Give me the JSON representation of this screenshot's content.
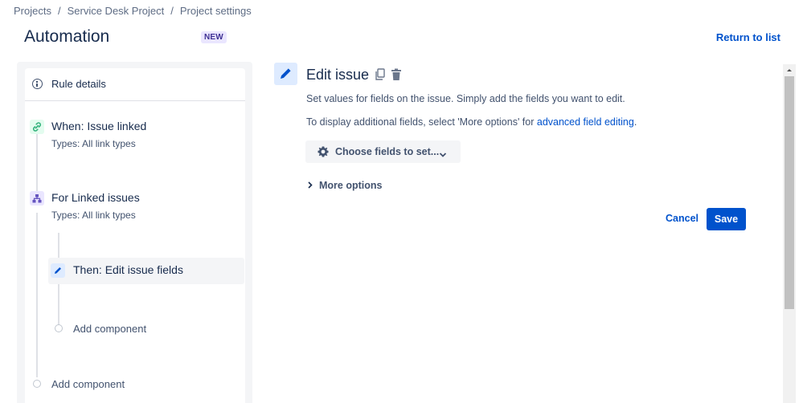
{
  "breadcrumb": {
    "items": [
      "Projects",
      "Service Desk Project",
      "Project settings"
    ],
    "separator": "/"
  },
  "header": {
    "title": "Automation",
    "badge": "NEW",
    "return_link": "Return to list"
  },
  "sidebar": {
    "rule_details": "Rule details",
    "trigger": {
      "title": "When: Issue linked",
      "subtitle": "Types: All link types",
      "icon": "link-icon"
    },
    "branch": {
      "title": "For Linked issues",
      "subtitle": "Types: All link types",
      "icon": "branch-icon"
    },
    "action": {
      "title": "Then: Edit issue fields",
      "icon": "pencil-icon"
    },
    "add_component_inner": "Add component",
    "add_component_outer": "Add component"
  },
  "editor": {
    "title": "Edit issue",
    "description": "Set values for fields on the issue. Simply add the fields you want to edit.",
    "more_fields_prefix": "To display additional fields, select 'More options' for ",
    "more_fields_link": "advanced field editing",
    "more_fields_suffix": ".",
    "choose_fields": "Choose fields to set...",
    "more_options": "More options",
    "cancel": "Cancel",
    "save": "Save"
  },
  "colors": {
    "primary": "#0052cc",
    "trigger_bg": "#e3fcef",
    "branch_bg": "#eae6ff",
    "action_bg": "#deebff"
  }
}
